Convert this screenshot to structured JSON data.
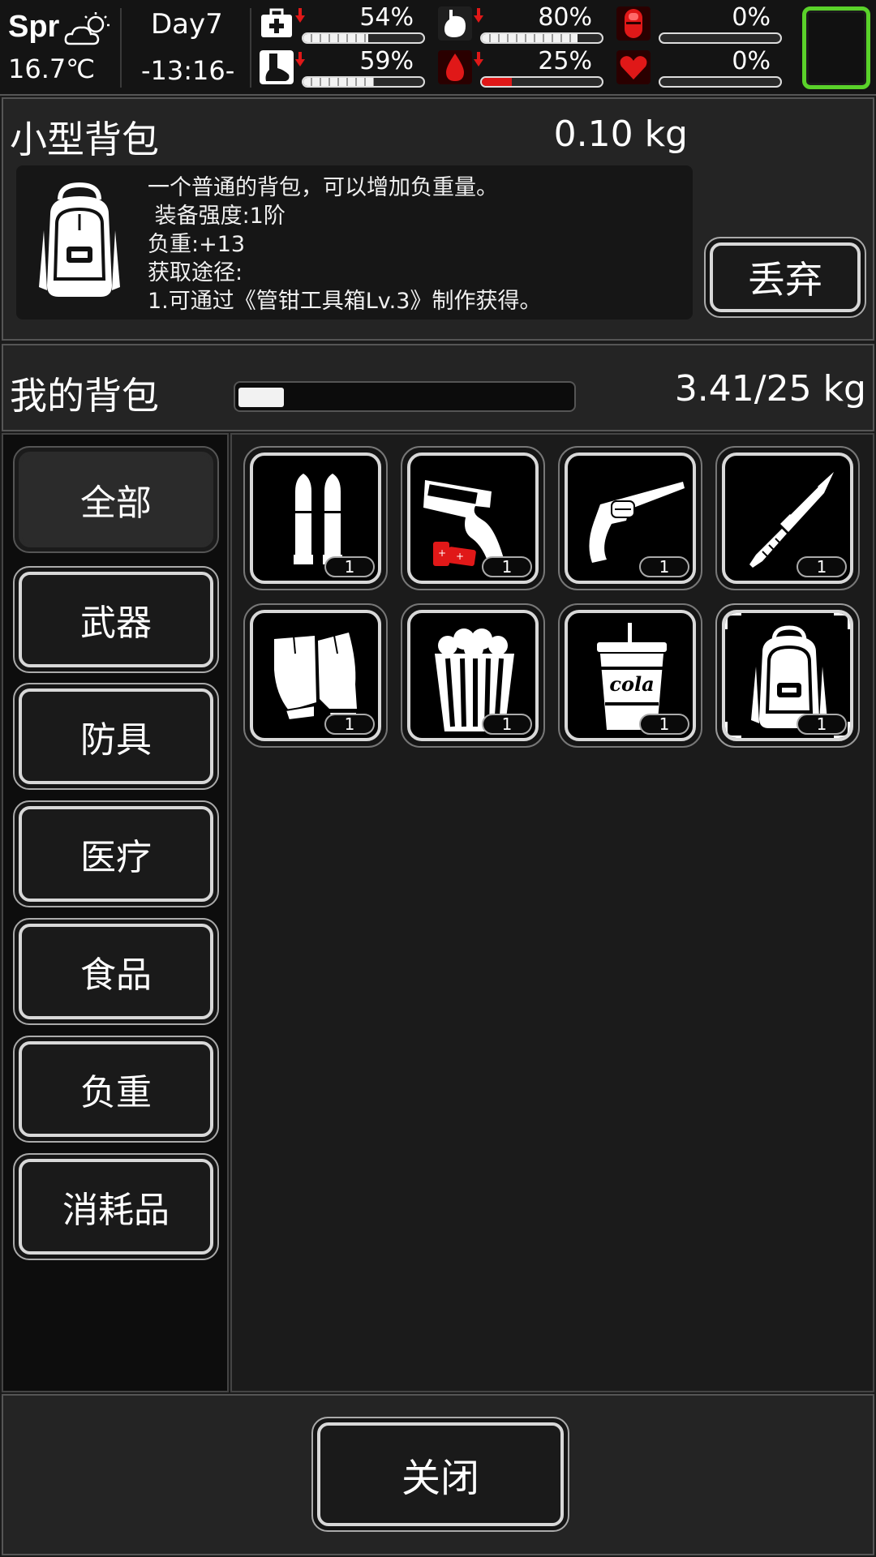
{
  "status": {
    "season": "Spr",
    "temperature": "16.7℃",
    "day": "Day7",
    "time": "-13:16-",
    "stats": [
      {
        "name": "health",
        "icon": "medkit-icon",
        "percent_text": "54%",
        "value": 0.54,
        "down": true,
        "color": "#f2f2f2"
      },
      {
        "name": "hunger",
        "icon": "stomach-icon",
        "percent_text": "80%",
        "value": 0.8,
        "down": true,
        "color": "#f2f2f2"
      },
      {
        "name": "infection",
        "icon": "pill-icon",
        "percent_text": "0%",
        "value": 0.0,
        "down": false,
        "color": "#f2f2f2"
      },
      {
        "name": "stamina",
        "icon": "foot-icon",
        "percent_text": "59%",
        "value": 0.59,
        "down": true,
        "color": "#f2f2f2"
      },
      {
        "name": "thirst",
        "icon": "water-drop-icon",
        "percent_text": "25%",
        "value": 0.25,
        "down": true,
        "color": "#e01818"
      },
      {
        "name": "mood",
        "icon": "heart-icon",
        "percent_text": "0%",
        "value": 0.0,
        "down": false,
        "color": "#f2f2f2"
      }
    ]
  },
  "detail": {
    "title": "小型背包",
    "weight": "0.10 kg",
    "lines": [
      "一个普通的背包，可以增加负重量。",
      " 装备强度:1阶",
      "负重:+13",
      "获取途径:",
      "1.可通过《管钳工具箱Lv.3》制作获得。"
    ],
    "icon": "backpack-icon",
    "discard_label": "丢弃"
  },
  "bag": {
    "title": "我的背包",
    "weight_text": "3.41/25 kg",
    "load_fraction": 0.1364
  },
  "categories": [
    {
      "label": "全部",
      "active": true
    },
    {
      "label": "武器",
      "active": false
    },
    {
      "label": "防具",
      "active": false
    },
    {
      "label": "医疗",
      "active": false
    },
    {
      "label": "食品",
      "active": false
    },
    {
      "label": "负重",
      "active": false
    },
    {
      "label": "消耗品",
      "active": false
    }
  ],
  "items": [
    {
      "icon": "bullets-icon",
      "count": "1"
    },
    {
      "icon": "flare-gun-icon",
      "count": "1"
    },
    {
      "icon": "revolver-icon",
      "count": "1"
    },
    {
      "icon": "knife-icon",
      "count": "1"
    },
    {
      "icon": "gloves-icon",
      "count": "1"
    },
    {
      "icon": "popcorn-icon",
      "count": "1"
    },
    {
      "icon": "cola-cup-icon",
      "count": "1",
      "label": "cola"
    },
    {
      "icon": "backpack-icon",
      "count": "1",
      "selected": true
    }
  ],
  "footer": {
    "close_label": "关闭"
  }
}
